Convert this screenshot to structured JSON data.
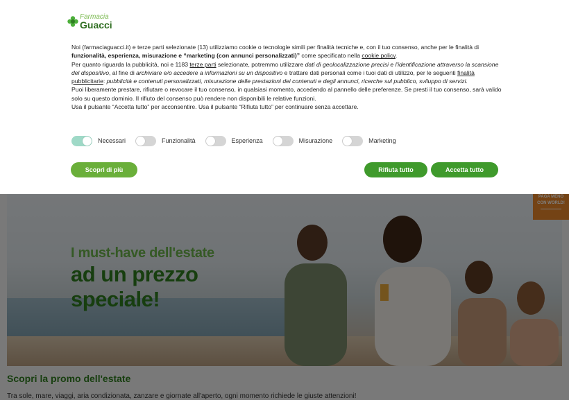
{
  "logo": {
    "small": "Farmacia",
    "big": "Guacci"
  },
  "banner": {
    "p1_a": "Noi (farmaciaguacci.it) e terze parti selezionate (13) utilizziamo cookie o tecnologie simili per finalità tecniche e, con il tuo consenso, anche per le finalità di ",
    "p1_b": "funzionalità, esperienza, misurazione e “marketing (con annunci personalizzati)”",
    "p1_c": " come specificato nella ",
    "p1_link": "cookie policy",
    "p1_d": ".",
    "p2_a": "Per quanto riguarda la pubblicità, noi e 1183 ",
    "p2_link1": "terze parti",
    "p2_b": " selezionate, potremmo utilizzare ",
    "p2_i1": "dati di geolocalizzazione precisi e l'identificazione attraverso la scansione del dispositivo",
    "p2_c": ", al fine di ",
    "p2_i2": "archiviare e/o accedere a informazioni su un dispositivo",
    "p2_d": " e trattare dati personali come i tuoi dati di utilizzo, per le seguenti ",
    "p2_link2": "finalità pubblicitarie",
    "p2_e": ": ",
    "p2_i3": "pubblicità e contenuti personalizzati, misurazione delle prestazioni dei contenuti e degli annunci, ricerche sul pubblico, sviluppo di servizi.",
    "p3": "Puoi liberamente prestare, rifiutare o revocare il tuo consenso, in qualsiasi momento, accedendo al pannello delle preferenze. Se presti il tuo consenso, sarà valido solo su questo dominio. Il rifiuto del consenso può rendere non disponibili le relative funzioni.",
    "p4": "Usa il pulsante “Accetta tutto” per acconsentire. Usa il pulsante “Rifiuta tutto” per continuare senza accettare."
  },
  "toggles": [
    {
      "label": "Necessari",
      "on": true
    },
    {
      "label": "Funzionalità",
      "on": false
    },
    {
      "label": "Esperienza",
      "on": false
    },
    {
      "label": "Misurazione",
      "on": false
    },
    {
      "label": "Marketing",
      "on": false
    }
  ],
  "buttons": {
    "more": "Scopri di più",
    "reject": "Rifiuta tutto",
    "accept": "Accetta tutto"
  },
  "hero": {
    "line1": "I must-have dell'estate",
    "line2": "ad un prezzo",
    "line3": "speciale!"
  },
  "side_tab": {
    "line1": "PAGA MENO",
    "line2": "CON WORLD!"
  },
  "promo": {
    "title": "Scopri la promo dell'estate",
    "subtitle": "Tra sole, mare, viaggi, aria condizionata, zanzare e giornate all'aperto, ogni momento richiede le giuste attenzioni!"
  },
  "colors": {
    "brand_green": "#3f9a2c",
    "light_green": "#6aaf3a",
    "toggle_on": "#9fd9c7",
    "side_tab": "#e8862a"
  }
}
